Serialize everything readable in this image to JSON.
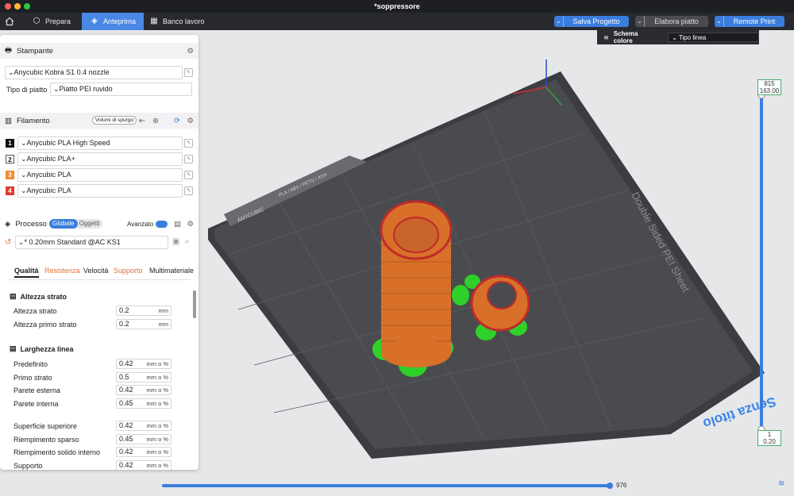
{
  "window": {
    "title": "*soppressore"
  },
  "toolbar": {
    "tabs": [
      {
        "label": "Prepara"
      },
      {
        "label": "Anteprima"
      },
      {
        "label": "Banco lavoro"
      }
    ],
    "save_label": "Salva Progetto",
    "slice_label": "Elabora piatto",
    "print_label": "Remote Print"
  },
  "color_scheme": {
    "label": "Schema colore",
    "value": "Tipo linea"
  },
  "printer": {
    "header": "Stampante",
    "name": "Anycubic Kobra S1 0.4 nozzle",
    "plate_type_label": "Tipo di piatto",
    "plate_type": "Piatto PEI ruvido"
  },
  "filament": {
    "header": "Filamento",
    "purge_button": "Volumi di spurgo",
    "items": [
      {
        "num": "1",
        "name": "Anycubic PLA High Speed",
        "color": "#111111"
      },
      {
        "num": "2",
        "name": "Anycubic PLA+",
        "color": "#ffffff"
      },
      {
        "num": "3",
        "name": "Anycubic PLA",
        "color": "#f28a2e"
      },
      {
        "num": "4",
        "name": "Anycubic PLA",
        "color": "#e03b30"
      }
    ]
  },
  "process": {
    "header": "Processo",
    "toggle_global": "Globale",
    "toggle_objects": "Oggetti",
    "advanced_label": "Avanzato",
    "profile": "* 0.20mm Standard @AC KS1",
    "tabs": [
      {
        "label": "Qualità"
      },
      {
        "label": "Resistenza"
      },
      {
        "label": "Velocità"
      },
      {
        "label": "Supporto"
      },
      {
        "label": "Multimateriale"
      }
    ]
  },
  "params": {
    "layer_height_group": "Altezza strato",
    "layer_height": {
      "label": "Altezza strato",
      "value": "0.2",
      "unit": "mm"
    },
    "first_layer_height": {
      "label": "Altezza primo strato",
      "value": "0.2",
      "unit": "mm"
    },
    "line_width_group": "Larghezza linea",
    "default": {
      "label": "Predefinito",
      "value": "0.42",
      "unit": "mm o %"
    },
    "first_layer": {
      "label": "Primo strato",
      "value": "0.5",
      "unit": "mm o %"
    },
    "outer_wall": {
      "label": "Parete esterna",
      "value": "0.42",
      "unit": "mm o %"
    },
    "inner_wall": {
      "label": "Parete interna",
      "value": "0.45",
      "unit": "mm o %"
    },
    "top_surface": {
      "label": "Superficie superiore",
      "value": "0.42",
      "unit": "mm o %"
    },
    "sparse_infill": {
      "label": "Riempimento sparso",
      "value": "0.45",
      "unit": "mm o %"
    },
    "internal_solid_infill": {
      "label": "Riempimento solido interno",
      "value": "0.42",
      "unit": "mm o %"
    },
    "support": {
      "label": "Supporto",
      "value": "0.42",
      "unit": "mm o %"
    }
  },
  "plate": {
    "sheet_label": "Double Sided PEI Sheet",
    "brand_label": "ANYCUBIC",
    "material_label": "PLA / ABS / PETG / ASA",
    "title": "Senza titolo"
  },
  "layer_slider": {
    "top_layer": "815",
    "top_height": "163.00",
    "bottom_layer": "1",
    "bottom_height": "0.20",
    "fill": 1.0
  },
  "move_slider": {
    "value": "976",
    "fill": 1.0
  }
}
